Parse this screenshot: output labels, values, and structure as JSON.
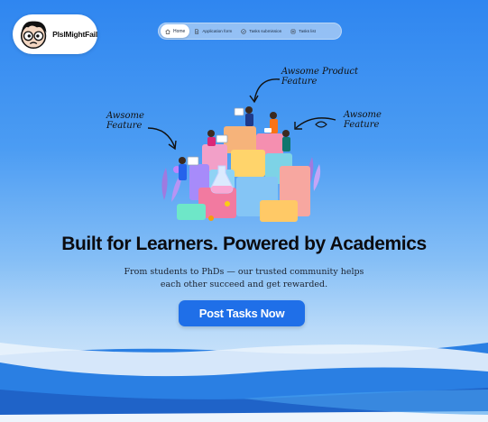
{
  "brand": {
    "name": "PlsIMightFail"
  },
  "nav": {
    "items": [
      {
        "label": "Home",
        "icon": "home-icon",
        "active": true
      },
      {
        "label": "Application form",
        "icon": "document-icon",
        "active": false
      },
      {
        "label": "Tasks submission",
        "icon": "check-circle-icon",
        "active": false
      },
      {
        "label": "Tasks list",
        "icon": "list-icon",
        "active": false
      }
    ]
  },
  "annotations": {
    "product_feature": [
      "Awsome Product",
      "Feature"
    ],
    "left_feature": [
      "Awsome",
      "Feature"
    ],
    "right_feature": [
      "Awsome",
      "Feature"
    ]
  },
  "hero": {
    "headline": "Built for Learners. Powered by Academics",
    "subline_1": "From students to PhDs — our trusted community helps",
    "subline_2": "each other succeed and get rewarded.",
    "cta_label": "Post Tasks Now"
  },
  "colors": {
    "primary": "#1f6fe8",
    "sky_top": "#2f86f0",
    "sky_bottom": "#e8f2fb"
  }
}
